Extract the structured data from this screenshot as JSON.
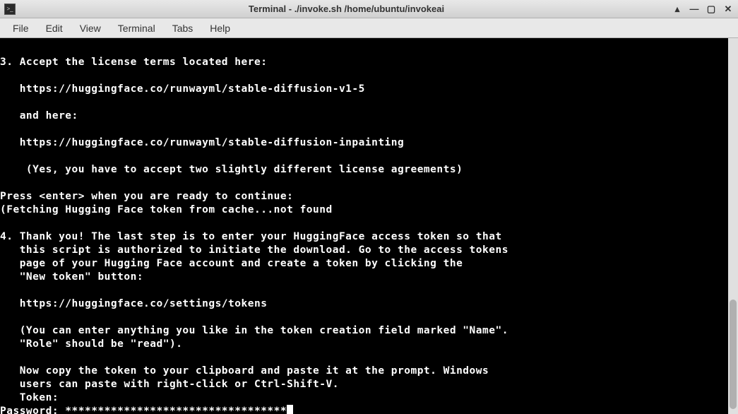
{
  "titlebar": {
    "title": "Terminal - ./invoke.sh /home/ubuntu/invokeai"
  },
  "window_controls": {
    "up": "▴",
    "min": "—",
    "max": "▢",
    "close": "✕"
  },
  "menubar": {
    "file": "File",
    "edit": "Edit",
    "view": "View",
    "terminal": "Terminal",
    "tabs": "Tabs",
    "help": "Help"
  },
  "terminal": {
    "lines": [
      "",
      "3. Accept the license terms located here:",
      "",
      "   https://huggingface.co/runwayml/stable-diffusion-v1-5",
      "",
      "   and here:",
      "",
      "   https://huggingface.co/runwayml/stable-diffusion-inpainting",
      "",
      "    (Yes, you have to accept two slightly different license agreements)",
      "",
      "Press <enter> when you are ready to continue:",
      "(Fetching Hugging Face token from cache...not found",
      "",
      "4. Thank you! The last step is to enter your HuggingFace access token so that",
      "   this script is authorized to initiate the download. Go to the access tokens",
      "   page of your Hugging Face account and create a token by clicking the",
      "   \"New token\" button:",
      "",
      "   https://huggingface.co/settings/tokens",
      "",
      "   (You can enter anything you like in the token creation field marked \"Name\".",
      "   \"Role\" should be \"read\").",
      "",
      "   Now copy the token to your clipboard and paste it at the prompt. Windows",
      "   users can paste with right-click or Ctrl-Shift-V.",
      "   Token:"
    ],
    "prompt_line": "Password: **********************************"
  }
}
